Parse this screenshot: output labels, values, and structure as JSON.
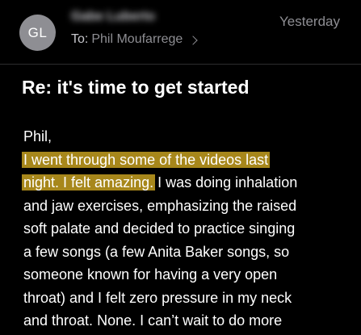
{
  "header": {
    "avatar_initials": "GL",
    "sender_name": "Gabe Luberto",
    "date": "Yesterday",
    "to_label": "To:",
    "recipient": "Phil Moufarrege"
  },
  "email": {
    "subject": "Re:  it's time to get started",
    "greeting": "Phil,",
    "lines": [
      {
        "highlight": "I went through some of the videos last",
        "rest": ""
      },
      {
        "highlight": "night. I felt amazing.",
        "rest": " I was doing inhalation"
      },
      {
        "highlight": "",
        "rest": "and jaw exercises, emphasizing the raised"
      },
      {
        "highlight": "",
        "rest": "soft palate and decided to practice singing"
      },
      {
        "highlight": "",
        "rest": "a few songs (a few Anita Baker songs, so"
      },
      {
        "highlight": "",
        "rest": "someone known for having a very open"
      },
      {
        "highlight": "",
        "rest": "throat) and I felt zero pressure in my neck"
      },
      {
        "highlight": "",
        "rest": "and throat. None. I can’t wait to do more"
      }
    ]
  },
  "colors": {
    "background": "#000000",
    "highlight": "#c9a227",
    "secondary_text": "#8e8e93"
  }
}
